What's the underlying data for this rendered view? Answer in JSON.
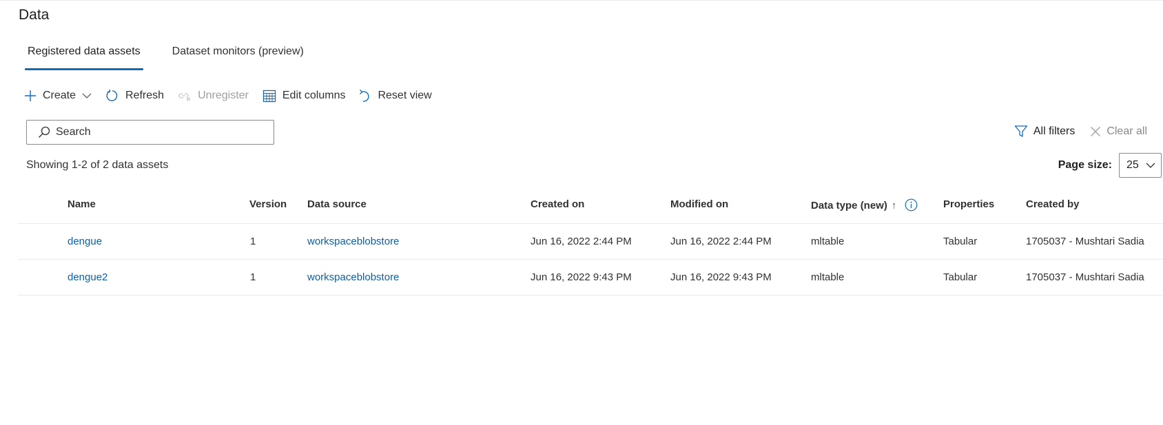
{
  "page": {
    "title": "Data"
  },
  "tabs": [
    {
      "label": "Registered data assets",
      "active": true
    },
    {
      "label": "Dataset monitors (preview)",
      "active": false
    }
  ],
  "toolbar": {
    "create": "Create",
    "refresh": "Refresh",
    "unregister": "Unregister",
    "edit_columns": "Edit columns",
    "reset_view": "Reset view"
  },
  "search": {
    "placeholder": "Search",
    "value": ""
  },
  "filters": {
    "all_filters": "All filters",
    "clear_all": "Clear all"
  },
  "summary": {
    "showing": "Showing 1-2 of 2 data assets"
  },
  "pagination": {
    "label": "Page size:",
    "value": "25"
  },
  "table": {
    "columns": {
      "name": "Name",
      "version": "Version",
      "data_source": "Data source",
      "created_on": "Created on",
      "modified_on": "Modified on",
      "data_type": "Data type (new)",
      "properties": "Properties",
      "created_by": "Created by"
    },
    "sort": {
      "column": "data_type",
      "direction": "ascending",
      "glyph": "↑"
    },
    "rows": [
      {
        "name": "dengue",
        "version": "1",
        "data_source": "workspaceblobstore",
        "created_on": "Jun 16, 2022 2:44 PM",
        "modified_on": "Jun 16, 2022 2:44 PM",
        "data_type": "mltable",
        "properties": "Tabular",
        "created_by": "1705037 - Mushtari Sadia"
      },
      {
        "name": "dengue2",
        "version": "1",
        "data_source": "workspaceblobstore",
        "created_on": "Jun 16, 2022 9:43 PM",
        "modified_on": "Jun 16, 2022 9:43 PM",
        "data_type": "mltable",
        "properties": "Tabular",
        "created_by": "1705037 - Mushtari Sadia"
      }
    ]
  },
  "colors": {
    "accent": "#0f6cbd",
    "link": "#0f5ea8",
    "disabled": "#a19f9d",
    "divider": "#edebe9"
  },
  "icons": {
    "create": "plus-icon",
    "create_menu": "chevron-down-icon",
    "refresh": "refresh-icon",
    "unregister": "unlink-icon",
    "edit_columns": "table-columns-icon",
    "reset_view": "undo-icon",
    "search": "search-icon",
    "all_filters": "filter-icon",
    "clear_all": "close-icon",
    "page_size": "chevron-down-icon",
    "data_type_info": "info-icon"
  }
}
